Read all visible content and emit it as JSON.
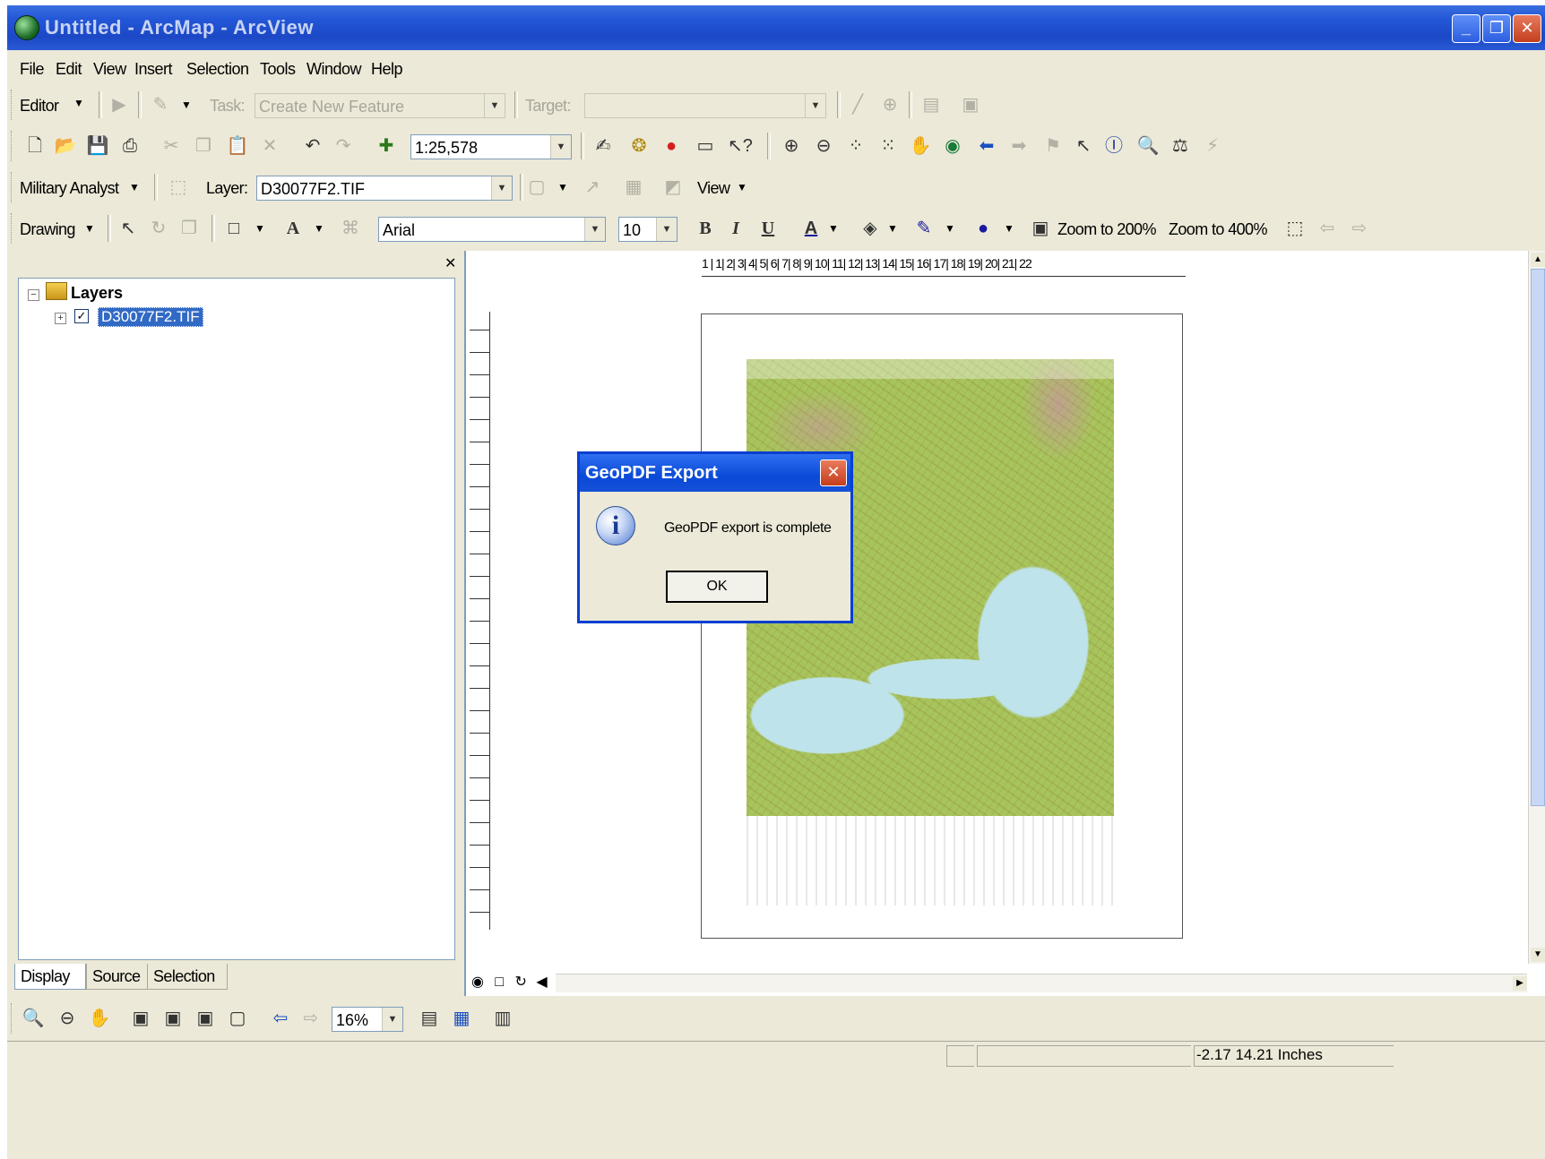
{
  "window": {
    "title": "Untitled - ArcMap - ArcView"
  },
  "menu": [
    "File",
    "Edit",
    "View",
    "Insert",
    "Selection",
    "Tools",
    "Window",
    "Help"
  ],
  "editor_toolbar": {
    "editor_label": "Editor",
    "task_label": "Task:",
    "task_value": "Create New Feature",
    "target_label": "Target:",
    "target_value": ""
  },
  "standard_toolbar": {
    "scale": "1:25,578"
  },
  "military_toolbar": {
    "analyst_label": "Military Analyst",
    "layer_label": "Layer:",
    "layer_value": "D30077F2.TIF",
    "view_label": "View"
  },
  "drawing_toolbar": {
    "drawing_label": "Drawing",
    "font_name": "Arial",
    "font_size": "10",
    "zoom_200": "Zoom to 200%",
    "zoom_400": "Zoom to 400%"
  },
  "toc": {
    "root_label": "Layers",
    "layers": [
      {
        "name": "D30077F2.TIF",
        "checked": true
      }
    ],
    "tabs": [
      "Display",
      "Source",
      "Selection"
    ]
  },
  "ruler": {
    "h": "1 | 1| 2| 3| 4| 5| 6| 7| 8| 9| 10| 11| 12| 13| 14| 15| 16| 17| 18| 19| 20| 21| 22"
  },
  "layout_toolbar": {
    "zoom": "16%"
  },
  "dialog": {
    "title": "GeoPDF Export",
    "message": "GeoPDF export is complete",
    "ok_label": "OK"
  },
  "status": {
    "coordinates": "-2.17  14.21 Inches"
  },
  "colors": {
    "titlebar": "#2357d8",
    "selection": "#316ac5",
    "dialog_border": "#0a3fd0"
  }
}
